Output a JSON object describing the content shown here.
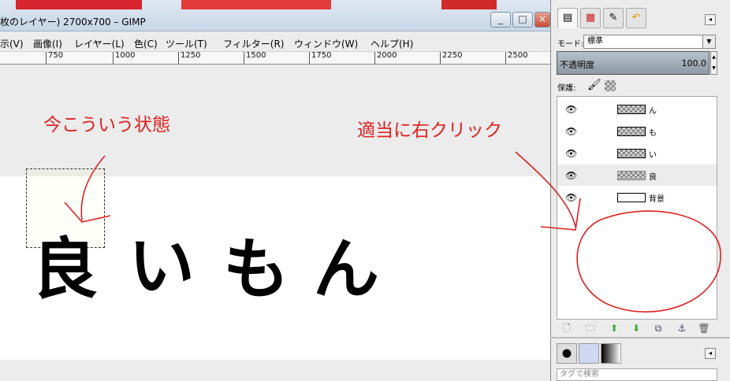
{
  "window": {
    "title": "枚のレイヤー) 2700x700 – GIMP",
    "min_label": "_",
    "max_label": "□",
    "close_label": "×"
  },
  "menubar": {
    "items": [
      "示(V)",
      "画像(I)",
      "レイヤー(L)",
      "色(C)",
      "ツール(T)",
      "フィルター(R)",
      "ウィンドウ(W)",
      "ヘルプ(H)"
    ]
  },
  "ruler": {
    "ticks": [
      "750",
      "1000",
      "1250",
      "1500",
      "1750",
      "2000",
      "2250",
      "2500"
    ]
  },
  "canvas_text": {
    "char1": "良",
    "char2": "い",
    "char3": "も",
    "char4": "ん"
  },
  "annotations": {
    "left": "今こういう状態",
    "right": "適当に右クリック",
    "color": "#e02020"
  },
  "dock": {
    "mode_label": "モード:",
    "mode_value": "標準",
    "opacity_label": "不透明度",
    "opacity_value": "100.0",
    "lock_label": "保護:",
    "layers": [
      {
        "name": "ん",
        "visible": true
      },
      {
        "name": "も",
        "visible": true
      },
      {
        "name": "い",
        "visible": true
      },
      {
        "name": "良",
        "visible": true,
        "selected": true
      },
      {
        "name": "背景",
        "visible": true
      }
    ],
    "tag_placeholder": "タグで検索"
  }
}
